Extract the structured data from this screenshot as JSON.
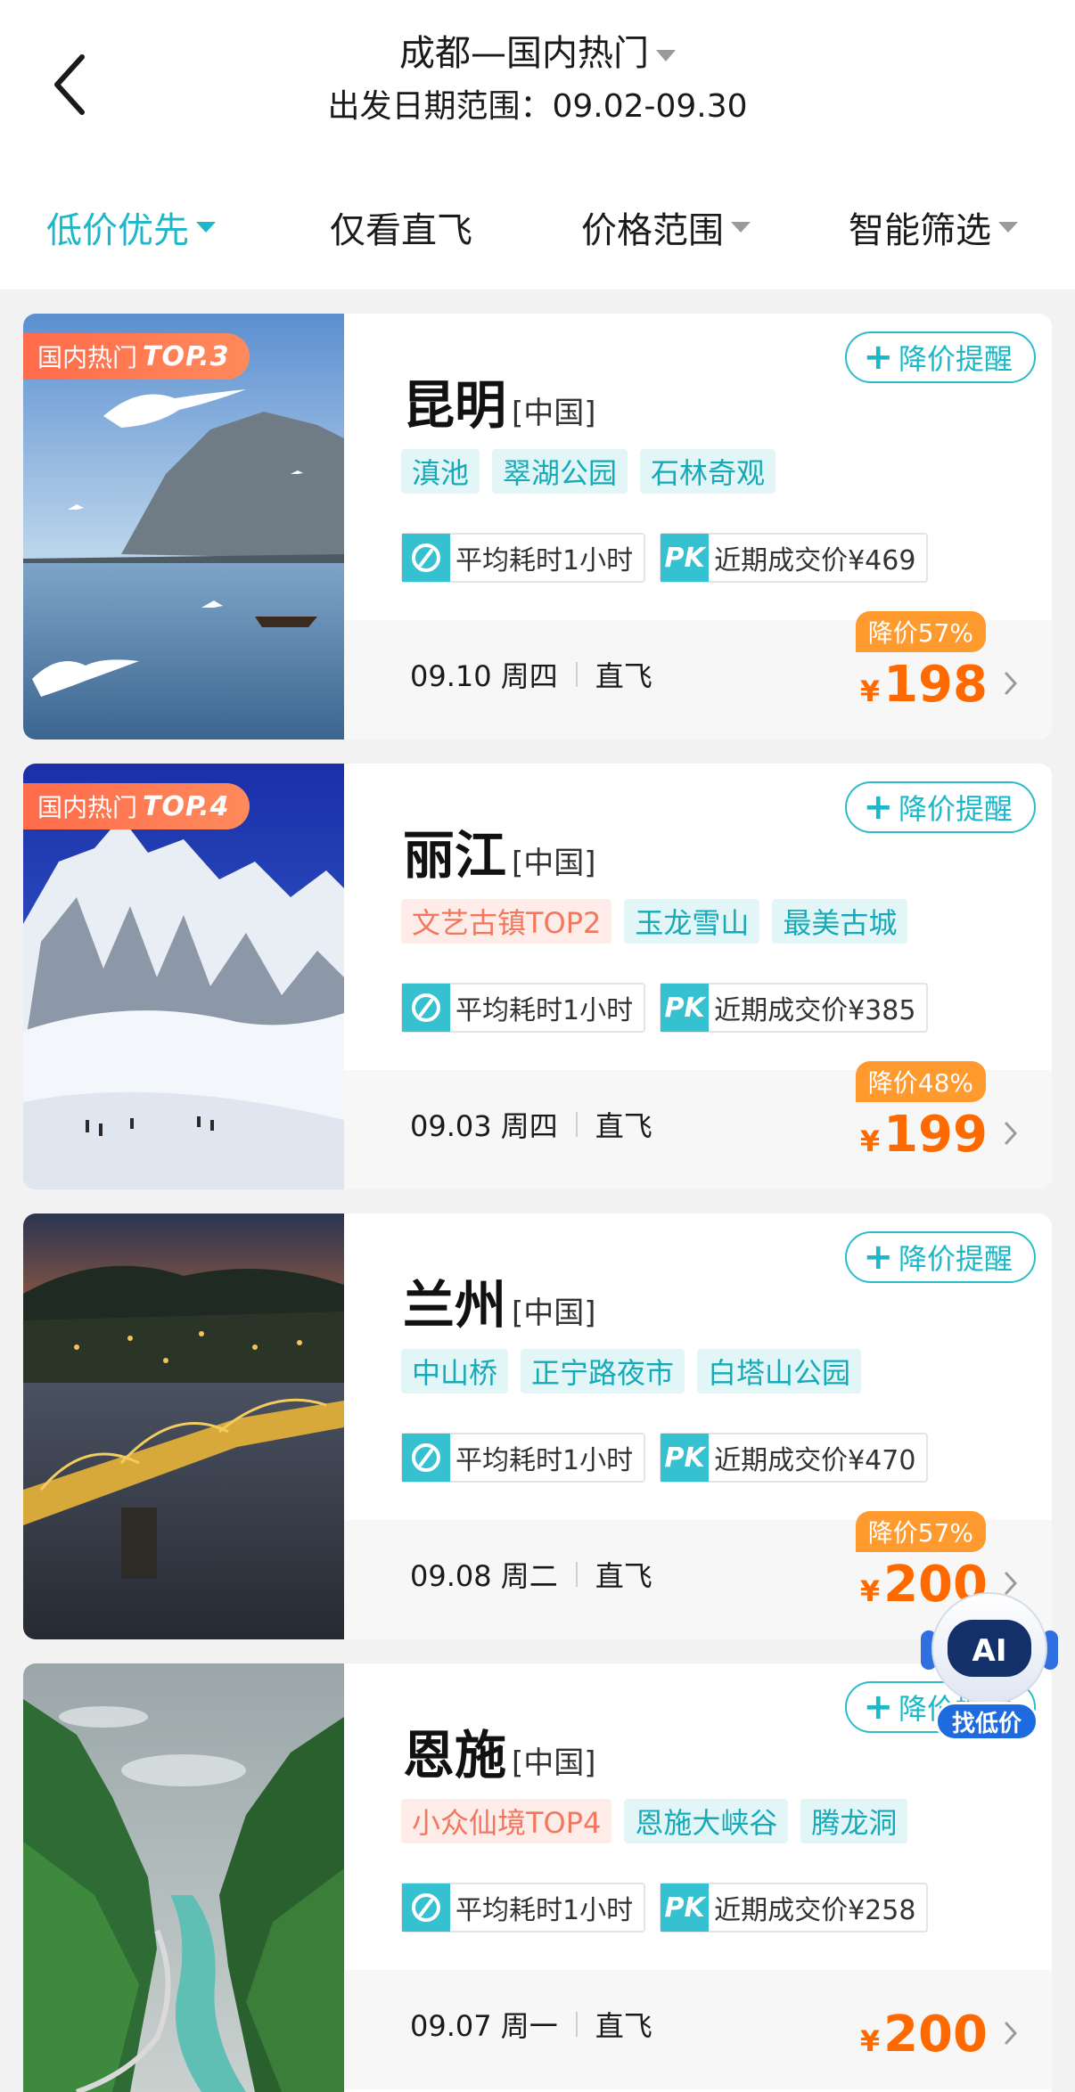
{
  "header": {
    "title": "成都—国内热门",
    "date_range": "出发日期范围：09.02-09.30"
  },
  "filters": [
    {
      "label": "低价优先",
      "active": true
    },
    {
      "label": "仅看直飞",
      "active": false
    },
    {
      "label": "价格范围",
      "active": false
    },
    {
      "label": "智能筛选",
      "active": false
    }
  ],
  "colors": {
    "accent": "#1ab8c9",
    "price": "#ff6a00",
    "discount": "#ff9a2e",
    "rank_badge": "#ff6a4a"
  },
  "cards": [
    {
      "rank_prefix": "国内热门",
      "rank": "TOP.3",
      "city": "昆明",
      "country": "[中国]",
      "alert": "降价提醒",
      "tags": [
        {
          "text": "滇池",
          "style": "cyan"
        },
        {
          "text": "翠湖公园",
          "style": "cyan"
        },
        {
          "text": "石林奇观",
          "style": "cyan"
        }
      ],
      "avg_time": "平均耗时1小时",
      "pk_icon": "PK",
      "recent_price": "近期成交价¥469",
      "date": "09.10 周四",
      "flight_type": "直飞",
      "discount": "降价57%",
      "currency": "¥",
      "price": "198"
    },
    {
      "rank_prefix": "国内热门",
      "rank": "TOP.4",
      "city": "丽江",
      "country": "[中国]",
      "alert": "降价提醒",
      "tags": [
        {
          "text": "文艺古镇TOP2",
          "style": "pink"
        },
        {
          "text": "玉龙雪山",
          "style": "cyan"
        },
        {
          "text": "最美古城",
          "style": "cyan"
        }
      ],
      "avg_time": "平均耗时1小时",
      "pk_icon": "PK",
      "recent_price": "近期成交价¥385",
      "date": "09.03 周四",
      "flight_type": "直飞",
      "discount": "降价48%",
      "currency": "¥",
      "price": "199"
    },
    {
      "city": "兰州",
      "country": "[中国]",
      "alert": "降价提醒",
      "tags": [
        {
          "text": "中山桥",
          "style": "cyan"
        },
        {
          "text": "正宁路夜市",
          "style": "cyan"
        },
        {
          "text": "白塔山公园",
          "style": "cyan"
        }
      ],
      "avg_time": "平均耗时1小时",
      "pk_icon": "PK",
      "recent_price": "近期成交价¥470",
      "date": "09.08 周二",
      "flight_type": "直飞",
      "discount": "降价57%",
      "currency": "¥",
      "price": "200"
    },
    {
      "city": "恩施",
      "country": "[中国]",
      "alert": "降价提醒",
      "tags": [
        {
          "text": "小众仙境TOP4",
          "style": "pink"
        },
        {
          "text": "恩施大峡谷",
          "style": "cyan"
        },
        {
          "text": "腾龙洞",
          "style": "cyan"
        }
      ],
      "avg_time": "平均耗时1小时",
      "pk_icon": "PK",
      "recent_price": "近期成交价¥258",
      "date": "09.07 周一",
      "flight_type": "直飞",
      "currency": "¥",
      "price": "200"
    }
  ],
  "ai_float": {
    "badge": "AI",
    "label": "找低价"
  }
}
